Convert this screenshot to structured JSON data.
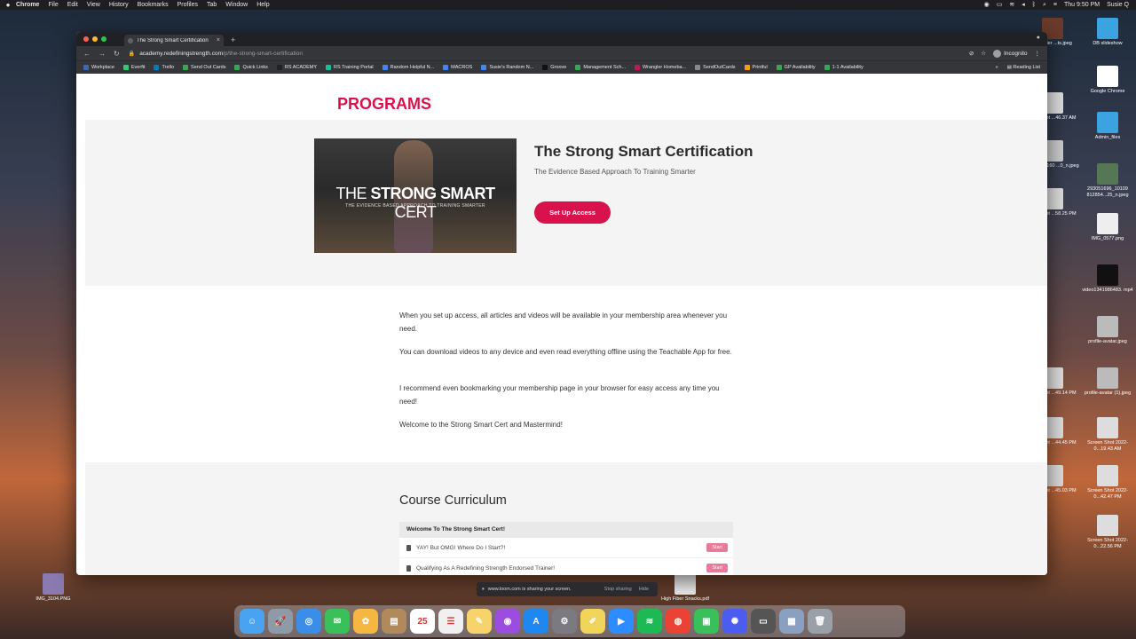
{
  "menubar": {
    "app": "Chrome",
    "items": [
      "File",
      "Edit",
      "View",
      "History",
      "Bookmarks",
      "Profiles",
      "Tab",
      "Window",
      "Help"
    ],
    "clock": "Thu 9:50 PM",
    "user": "Susie Q"
  },
  "browser": {
    "tab_title": "The Strong Smart Certification",
    "url_host": "academy.redefiningstrength.com",
    "url_path": "/p/the-strong-smart-certification",
    "incognito_label": "Incognito",
    "bookmarks": [
      {
        "label": "Workplace",
        "color": "#4267b2"
      },
      {
        "label": "Everfit",
        "color": "#2ecc71"
      },
      {
        "label": "Trello",
        "color": "#0079bf"
      },
      {
        "label": "Send Out Cards",
        "color": "#34a853"
      },
      {
        "label": "Quick Links",
        "color": "#34a853"
      },
      {
        "label": "RS ACADEMY",
        "color": "#222222"
      },
      {
        "label": "RS Training Portal",
        "color": "#1abc9c"
      },
      {
        "label": "Random Helpful N...",
        "color": "#4285f4"
      },
      {
        "label": "MACROS",
        "color": "#4285f4"
      },
      {
        "label": "Susie's Random N...",
        "color": "#4285f4"
      },
      {
        "label": "Groove",
        "color": "#111111"
      },
      {
        "label": "Management Sch...",
        "color": "#34a853"
      },
      {
        "label": "Wrangler Homeba...",
        "color": "#c2185b"
      },
      {
        "label": "SendOutCards",
        "color": "#888888"
      },
      {
        "label": "Printful",
        "color": "#f39c12"
      },
      {
        "label": "GP Availability",
        "color": "#34a853"
      },
      {
        "label": "1-1 Availability",
        "color": "#34a853"
      }
    ],
    "reading_list": "Reading List"
  },
  "page": {
    "logo_text": "PROGRAMS",
    "hero": {
      "image_text_light": "THE ",
      "image_text_bold": "STRONG SMART",
      "image_text_end": " CERT",
      "image_subtext": "THE EVIDENCE BASED APPROACH TO TRAINING SMARTER",
      "title": "The Strong Smart Certification",
      "subtitle": "The Evidence Based Approach To Training Smarter",
      "cta": "Set Up Access"
    },
    "intro": [
      "When you set up access, all articles and videos will be available in your membership area whenever you need.",
      "You can download videos to any device and even read everything offline using the Teachable App for free.",
      "I recommend even bookmarking your membership page in your browser for easy access any time you need!",
      "Welcome to the Strong Smart Cert and Mastermind!"
    ],
    "curriculum": {
      "title": "Course Curriculum",
      "section": "Welcome To The Strong Smart Cert!",
      "lectures": [
        {
          "title": "YAY! But OMG! Where Do I Start?!",
          "action": "Start"
        },
        {
          "title": "Qualifying As A Redefining Strength Endorsed Trainer!",
          "action": "Start"
        }
      ]
    }
  },
  "loom": {
    "message": "www.loom.com is sharing your screen.",
    "stop": "Stop sharing",
    "hide": "Hide"
  },
  "desktop": {
    "icons": [
      {
        "label": "...Sinkler ...ts.jpeg",
        "color": "#6b3a2a"
      },
      {
        "label": "DB slideshow",
        "color": "#3ba3e0"
      },
      {
        "label": "Google Chrome",
        "color": "#ffffff"
      },
      {
        "label": "...en Shot ...46.37 AM",
        "color": "#dddddd"
      },
      {
        "label": "Admin_files",
        "color": "#3ba3e0"
      },
      {
        "label": "...514_10160 ...0_n.jpeg",
        "color": "#cccccc"
      },
      {
        "label": "293051696_10109 812854...25_n.jpeg",
        "color": "#557755"
      },
      {
        "label": "...en Shot ...58.25 PM",
        "color": "#dddddd"
      },
      {
        "label": "IMG_0577.png",
        "color": "#eeeeee"
      },
      {
        "label": "video1341986483. mp4",
        "color": "#111111"
      },
      {
        "label": "profile-avatar.jpeg",
        "color": "#bbbbbb"
      },
      {
        "label": "...en Shot ...49.14 PM",
        "color": "#dddddd"
      },
      {
        "label": "profile-avatar (1).jpeg",
        "color": "#bbbbbb"
      },
      {
        "label": "...en Shot ...44.45 PM",
        "color": "#dddddd"
      },
      {
        "label": "Screen Shot 2022-0...19.43 AM",
        "color": "#dddddd"
      },
      {
        "label": "...en Shot ...45.03 PM",
        "color": "#dddddd"
      },
      {
        "label": "Screen Shot 2022-0...42.47 PM",
        "color": "#dddddd"
      },
      {
        "label": "Screen Shot 2022-0...22.56 PM",
        "color": "#dddddd"
      },
      {
        "label": "IMG_3104.PNG",
        "color": "#8a7ab0"
      },
      {
        "label": "High Fiber Snacks.pdf",
        "color": "#eeeeee"
      }
    ]
  },
  "dock": {
    "apps": [
      {
        "name": "finder-icon",
        "color": "#4aa3f0",
        "glyph": "☺"
      },
      {
        "name": "launchpad-icon",
        "color": "#8e9aa8",
        "glyph": "🚀"
      },
      {
        "name": "safari-icon",
        "color": "#3b8ee8",
        "glyph": "◎"
      },
      {
        "name": "messages-icon",
        "color": "#39c05a",
        "glyph": "✉"
      },
      {
        "name": "photos-icon",
        "color": "#f5b642",
        "glyph": "✿"
      },
      {
        "name": "contacts-icon",
        "color": "#b08a5a",
        "glyph": "▤"
      },
      {
        "name": "calendar-icon",
        "color": "#ffffff",
        "glyph": "25"
      },
      {
        "name": "reminders-icon",
        "color": "#f0f0f0",
        "glyph": "☰"
      },
      {
        "name": "notes-icon",
        "color": "#f7d36b",
        "glyph": "✎"
      },
      {
        "name": "podcasts-icon",
        "color": "#9b4de0",
        "glyph": "◉"
      },
      {
        "name": "appstore-icon",
        "color": "#1e88f0",
        "glyph": "A"
      },
      {
        "name": "settings-icon",
        "color": "#7a7a80",
        "glyph": "⚙"
      },
      {
        "name": "stickies-icon",
        "color": "#f1d45a",
        "glyph": "✐"
      },
      {
        "name": "zoom-icon",
        "color": "#2d8cff",
        "glyph": "▶"
      },
      {
        "name": "spotify-icon",
        "color": "#1db954",
        "glyph": "≋"
      },
      {
        "name": "chrome-icon",
        "color": "#ea4335",
        "glyph": "◍"
      },
      {
        "name": "facetime-icon",
        "color": "#39c05a",
        "glyph": "▣"
      },
      {
        "name": "loom-icon",
        "color": "#4b5cf0",
        "glyph": "✺"
      },
      {
        "name": "printer-icon",
        "color": "#555555",
        "glyph": "▭"
      },
      {
        "name": "preview-icon",
        "color": "#8aa0c0",
        "glyph": "▦"
      },
      {
        "name": "trash-icon",
        "color": "#9aa0a8",
        "glyph": "🗑"
      }
    ]
  }
}
